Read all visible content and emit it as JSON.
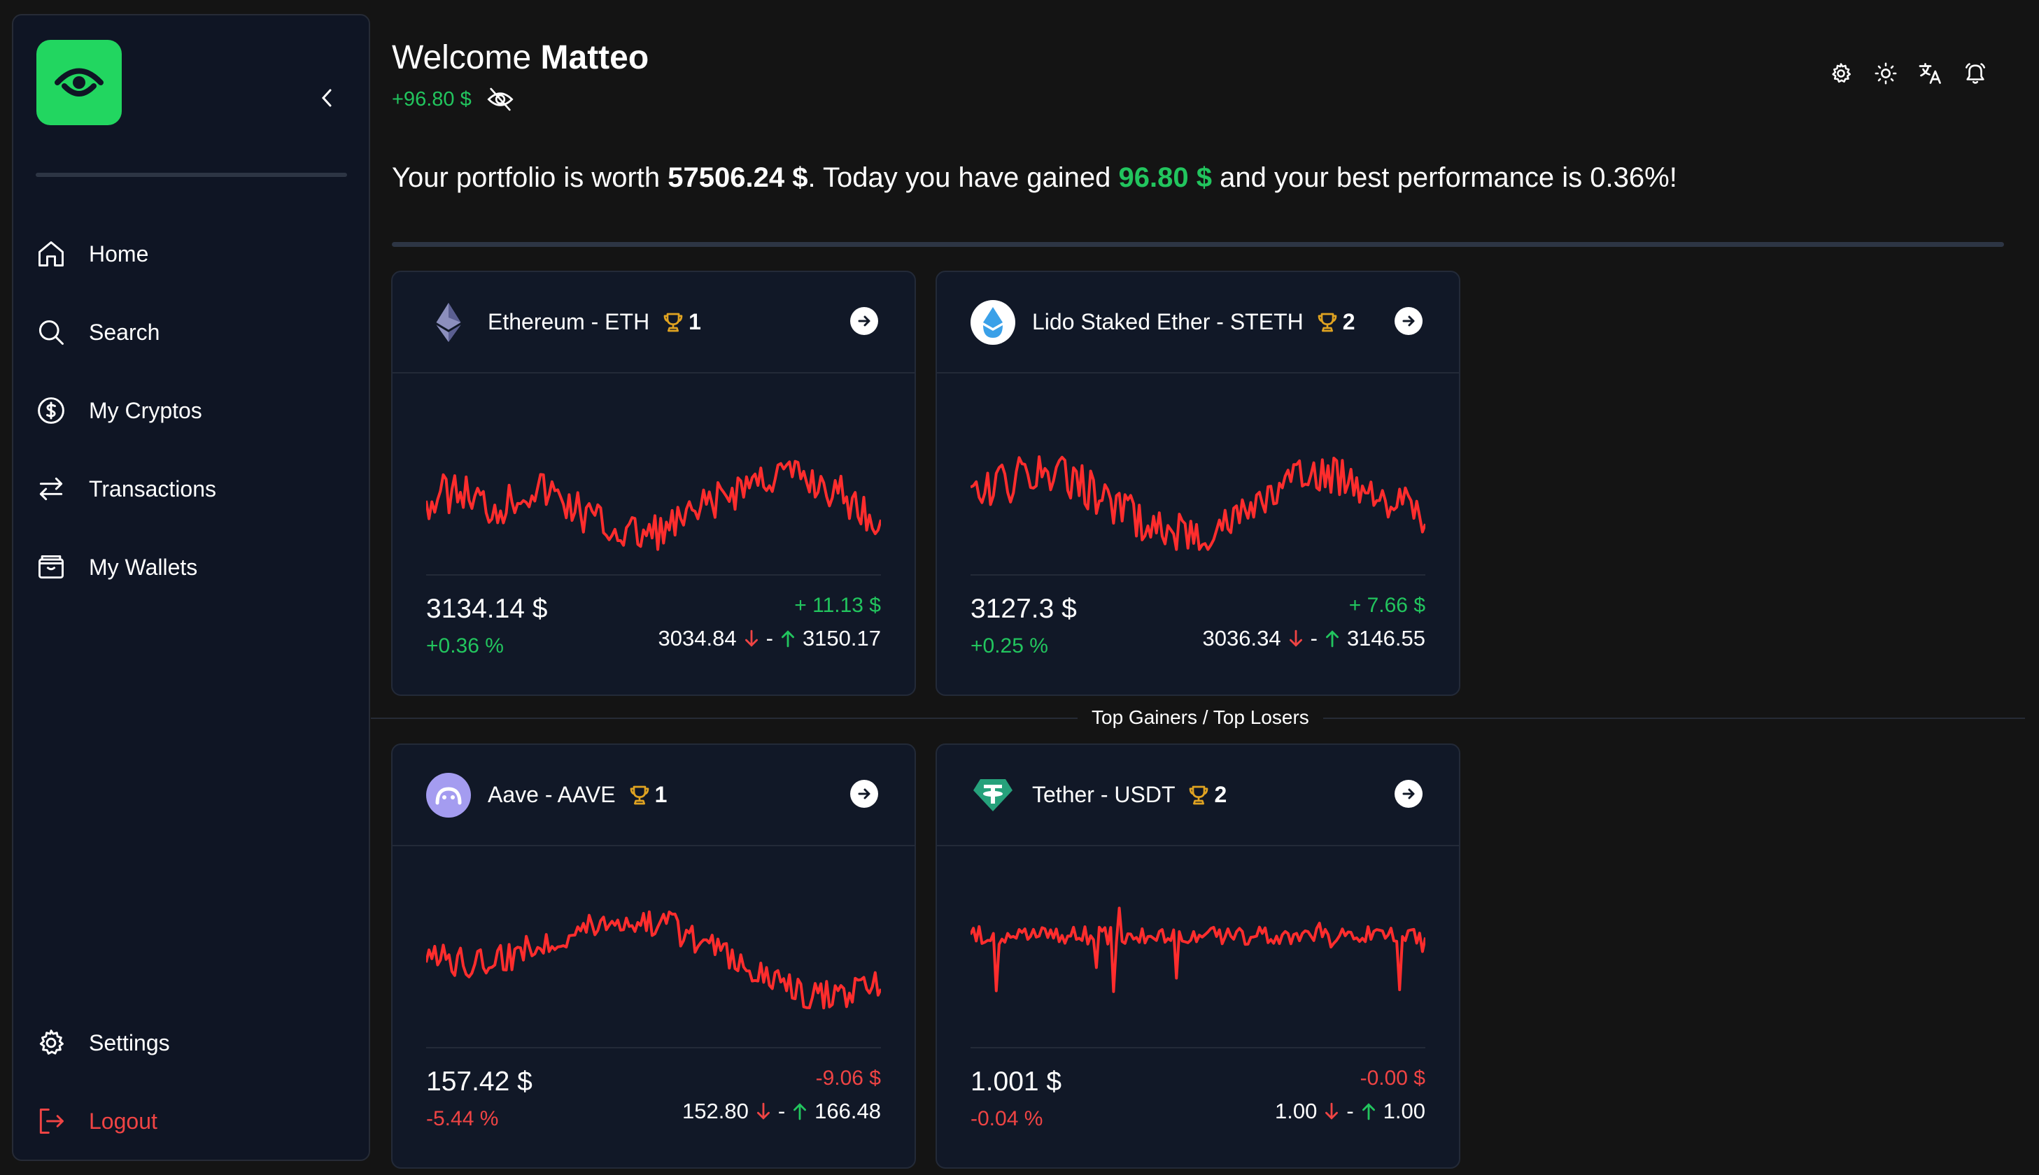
{
  "sidebar": {
    "nav": [
      {
        "label": "Home",
        "icon": "home-icon"
      },
      {
        "label": "Search",
        "icon": "search-icon"
      },
      {
        "label": "My Cryptos",
        "icon": "dollar-circle-icon"
      },
      {
        "label": "Transactions",
        "icon": "transfer-arrows-icon"
      },
      {
        "label": "My Wallets",
        "icon": "wallet-icon"
      }
    ],
    "settings_label": "Settings",
    "logout_label": "Logout"
  },
  "header": {
    "welcome_prefix": "Welcome",
    "user_name": "Matteo",
    "balance": "+96.80 $"
  },
  "summary": {
    "part1": "Your portfolio is worth ",
    "worth": "57506.24 $",
    "part2": ". Today you have gained ",
    "gained": "96.80 $",
    "part3": " and your best performance is 0.36%!"
  },
  "section_label": "Top Gainers / Top Losers",
  "cards": [
    {
      "name": "Ethereum - ETH",
      "rank": "1",
      "price": "3134.14 $",
      "pct": "+0.36 %",
      "change": "+ 11.13 $",
      "low": "3034.84",
      "sep": "-",
      "high": "3150.17",
      "trend": "up"
    },
    {
      "name": "Lido Staked Ether - STETH",
      "rank": "2",
      "price": "3127.3 $",
      "pct": "+0.25 %",
      "change": "+ 7.66 $",
      "low": "3036.34",
      "sep": "-",
      "high": "3146.55",
      "trend": "up"
    },
    {
      "name": "Aave - AAVE",
      "rank": "1",
      "price": "157.42 $",
      "pct": "-5.44 %",
      "change": "-9.06 $",
      "low": "152.80",
      "sep": "-",
      "high": "166.48",
      "trend": "down"
    },
    {
      "name": "Tether - USDT",
      "rank": "2",
      "price": "1.001 $",
      "pct": "-0.04 %",
      "change": "-0.00 $",
      "low": "1.00",
      "sep": "-",
      "high": "1.00",
      "trend": "down"
    }
  ],
  "colors": {
    "accent": "#22d660",
    "positive": "#22c55e",
    "negative": "#ef4444",
    "spark": "#ff2d2d",
    "trophy": "#e0a321"
  }
}
